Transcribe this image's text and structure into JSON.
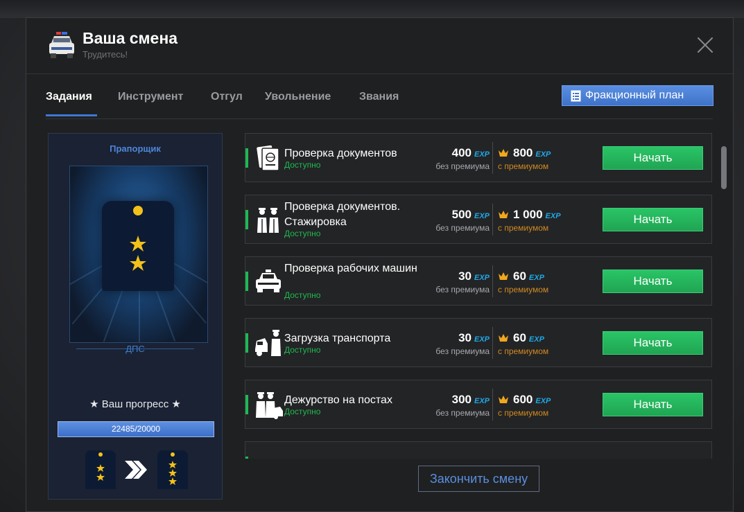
{
  "header": {
    "title": "Ваша смена",
    "subtitle": "Трудитесь!"
  },
  "tabs": [
    {
      "label": "Задания",
      "active": true
    },
    {
      "label": "Инструмент",
      "active": false
    },
    {
      "label": "Отгул",
      "active": false
    },
    {
      "label": "Увольнение",
      "active": false
    },
    {
      "label": "Звания",
      "active": false
    }
  ],
  "faction_plan_label": "Фракционный план",
  "rank": {
    "name": "Прапорщик",
    "unit": "ДПС",
    "progress_label": "★ Ваш прогресс ★",
    "progress_text": "22485/20000",
    "progress_fraction": 1.0
  },
  "tasks": [
    {
      "name": "Проверка документов",
      "status": "Доступно",
      "base": "400",
      "premium": "800",
      "exp": "EXP",
      "base_label": "без премиума",
      "premium_label": "с премиумом",
      "button": "Начать",
      "icon": "passport-icon"
    },
    {
      "name": "Проверка документов. Стажировка",
      "status": "Доступно",
      "base": "500",
      "premium": "1 000",
      "exp": "EXP",
      "base_label": "без премиума",
      "premium_label": "с премиумом",
      "button": "Начать",
      "icon": "officers-icon"
    },
    {
      "name": "Проверка рабочих машин",
      "status": "Доступно",
      "base": "30",
      "premium": "60",
      "exp": "EXP",
      "base_label": "без премиума",
      "premium_label": "с премиумом",
      "button": "Начать",
      "icon": "police-car-icon"
    },
    {
      "name": "Загрузка транспорта",
      "status": "Доступно",
      "base": "30",
      "premium": "60",
      "exp": "EXP",
      "base_label": "без премиума",
      "premium_label": "с премиумом",
      "button": "Начать",
      "icon": "tow-officer-icon"
    },
    {
      "name": "Дежурство на постах",
      "status": "Доступно",
      "base": "300",
      "premium": "600",
      "exp": "EXP",
      "base_label": "без премиума",
      "premium_label": "с премиумом",
      "button": "Начать",
      "icon": "post-duty-icon"
    }
  ],
  "finish_button": "Закончить смену",
  "colors": {
    "accent_blue": "#3b78d4",
    "green": "#20a553",
    "exp_cyan": "#1fa9e8",
    "premium_orange": "#d08a22"
  }
}
